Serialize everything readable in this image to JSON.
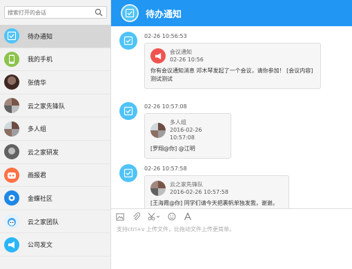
{
  "search": {
    "placeholder": "搜索打开的会话"
  },
  "sidebar": {
    "items": [
      {
        "label": "待办通知",
        "icon": "todo-check-icon",
        "color": "#4fc3f7"
      },
      {
        "label": "我的手机",
        "icon": "phone-icon",
        "color": "#8bc34a"
      },
      {
        "label": "张倩华",
        "icon": "user-avatar",
        "color": "#5d4037"
      },
      {
        "label": "云之家先锋队",
        "icon": "group-avatar",
        "color": "#9e9e9e"
      },
      {
        "label": "多人组",
        "icon": "group-avatar",
        "color": "#9e9e9e"
      },
      {
        "label": "云之家研发",
        "icon": "group-avatar",
        "color": "#757575"
      },
      {
        "label": "画报君",
        "icon": "bot-avatar",
        "color": "#ff7043"
      },
      {
        "label": "金蝶社区",
        "icon": "community-avatar",
        "color": "#1e88e5"
      },
      {
        "label": "云之家团队",
        "icon": "mascot-avatar",
        "color": "#42a5f5"
      },
      {
        "label": "公司发文",
        "icon": "megaphone-icon",
        "color": "#29b6f6"
      }
    ]
  },
  "header": {
    "title": "待办通知",
    "bg": "#2196f3"
  },
  "messages": [
    {
      "time": "02-26 10:56:53",
      "sender": "会议通知",
      "date": "02-26 10:56",
      "text": "你有会议通知消息 邓木琴发起了一个会议，请你参加！ [会议内容]测试测试"
    },
    {
      "time": "02-26 10:57:08",
      "sender": "多人组",
      "date": "2016-02-26 10:57:08",
      "text": "[罗翔@你] @江明"
    },
    {
      "time": "02-26 10:57:58",
      "sender": "云之家先锋队",
      "date": "2016-02-26 10:57:58",
      "text": "[王海霞@你] 同学们请今天把裹帆单独发我，谢谢。@ALL"
    }
  ],
  "input": {
    "hint": "支持ctrl+v 上传文件，比拖动文件上传更简单。"
  }
}
